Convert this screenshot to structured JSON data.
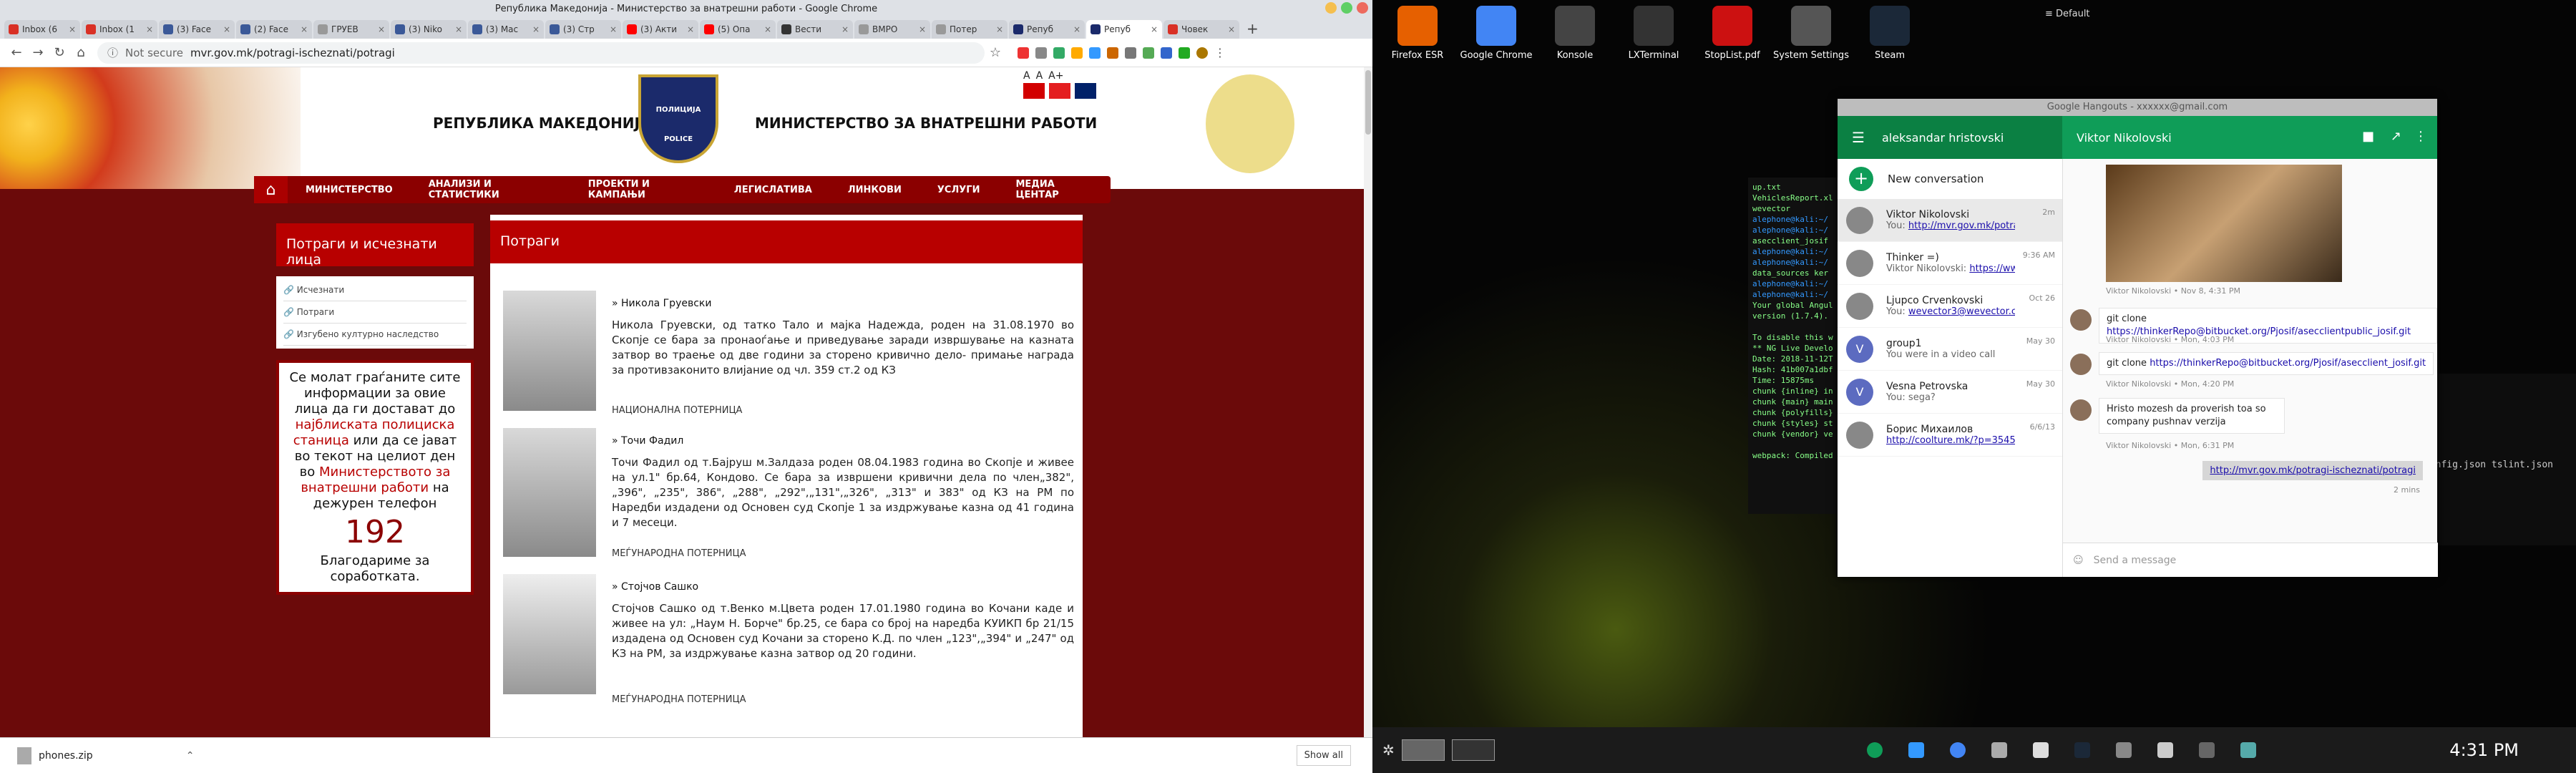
{
  "window": {
    "title": "Република Македонија - Министерство за внатрешни работи - Google Chrome"
  },
  "tabs": [
    {
      "label": "Inbox (6",
      "color": "#d93025"
    },
    {
      "label": "Inbox (1",
      "color": "#d93025"
    },
    {
      "label": "(3) Face",
      "color": "#3b5998"
    },
    {
      "label": "(2) Face",
      "color": "#3b5998"
    },
    {
      "label": "ГРУЕВ",
      "color": "#999999"
    },
    {
      "label": "(3) Niko",
      "color": "#3b5998"
    },
    {
      "label": "(3) Mac",
      "color": "#3b5998"
    },
    {
      "label": "(3) Стр",
      "color": "#3b5998"
    },
    {
      "label": "(3) Акти",
      "color": "#ff0000"
    },
    {
      "label": "(5) Опа",
      "color": "#ff0000"
    },
    {
      "label": "Вести",
      "color": "#333333"
    },
    {
      "label": "ВМРО",
      "color": "#999999"
    },
    {
      "label": "Потер",
      "color": "#999999"
    },
    {
      "label": "Репуб",
      "color": "#1b2a6b"
    },
    {
      "label": "Репуб",
      "color": "#1b2a6b"
    },
    {
      "label": "Човек",
      "color": "#d93025"
    }
  ],
  "omnibox": {
    "security": "Not secure",
    "url": "mvr.gov.mk/potragi-ischeznati/potragi"
  },
  "site": {
    "republic": "РЕПУБЛИКА МАКЕДОНИЈА",
    "ministry": "МИНИСТЕРСТВО ЗА ВНАТРЕШНИ РАБОТИ",
    "badge_top": "ПОЛИЦИЈА",
    "badge_bottom": "POLICE",
    "font_sizes": [
      "A",
      "A",
      "A+"
    ],
    "menu": [
      "МИНИСТЕРСТВО",
      "АНАЛИЗИ И СТАТИСТИКИ",
      "ПРОЕКТИ И КАМПАЊИ",
      "ЛЕГИСЛАТИВА",
      "ЛИНКОВИ",
      "УСЛУГИ",
      "МЕДИА ЦЕНТАР"
    ],
    "sidebar": {
      "title": "Потраги и исчезнати лица",
      "links": [
        "Исчезнати",
        "Потраги",
        "Изгубено културно наследство"
      ],
      "call_1": "Се молат граѓаните сите информации за овие лица да ги достават до",
      "call_2": "најблиската полициска станица",
      "call_3": "или да се јават во текот на целиот ден во",
      "call_4": "Министерството за внатрешни работи",
      "call_5": "на дежурен телефон",
      "phone": "192",
      "thanks": "Благодариме за соработката."
    },
    "main_title": "Потраги",
    "persons": [
      {
        "name": "» Никола Груевски",
        "text": "Никола Груевски, од татко Тало и мајка Надежда, роден на 31.08.1970 во Скопје се бара за пронаоѓање и приведување заради извршување на казната затвор во траење од две години за сторено кривично дело- примање награда за противзаконито влијание од чл. 359 ст.2 од КЗ",
        "tag": "НАЦИОНАЛНА ПОТЕРНИЦА"
      },
      {
        "name": "» Точи Фадил",
        "text": "Точи Фадил од т.Бајруш м.Залдаза роден 08.04.1983 година во Скопје и живее на ул.1\" бр.64, Кондово. Се бара за извршени кривични дела по член„382\", „396\", „235\", 386\", „288\", „292\",„131\",„326\", „313\" и 383\" од КЗ на РМ по Наредби издадени од Основен суд Скопје 1 за издржување казна од 41 година и 7 месеци.",
        "tag": "МЕЃУНАРОДНА ПОТЕРНИЦА"
      },
      {
        "name": "» Стојчов Сашко",
        "text": "Стојчов Сашко од т.Венко м.Цвета роден 17.01.1980 година во Кочани каде и живее на ул: „Наум Н. Борче\" бр.25, се бара со број на наредба КУИКП бр 21/15 издадена од Основен суд Кочани за сторено К.Д. по член „123\",„394\" и „247\" од КЗ на РМ, за издржување казна затвор од 20 години.",
        "tag": "МЕЃУНАРОДНА ПОТЕРНИЦА"
      }
    ]
  },
  "downloads": {
    "file": "phones.zip",
    "show_all": "Show all"
  },
  "desktop": {
    "icons": [
      "Firefox ESR",
      "Google Chrome",
      "Konsole",
      "LXTerminal",
      "StopList.pdf",
      "System Settings",
      "Steam"
    ],
    "icon_colors": [
      "#e66000",
      "#4285f4",
      "#444444",
      "#333333",
      "#cc1111",
      "#555555",
      "#1b2838"
    ],
    "activity": "Default",
    "clock": "4:31 PM"
  },
  "terminal": {
    "lines": [
      "up.txt",
      "VehiclesReport.xl",
      "wevector",
      "alephone@kali:~/",
      "alephone@kali:~/",
      "asecclient_josif",
      "alephone@kali:~/",
      "alephone@kali:~/",
      "data_sources  ker",
      "alephone@kali:~/",
      "alephone@kali:~/",
      "Your global Angul",
      "version (1.7.4).",
      "",
      "To disable this w",
      "** NG Live Develo",
      "Date: 2018-11-12T",
      "Hash: 41b007a1dbf",
      "Time: 15875ms",
      "chunk {inline} in",
      "chunk {main} main",
      "chunk {polyfills}",
      "chunk {styles} st",
      "chunk {vendor} ve",
      "",
      "webpack: Compiled"
    ],
    "other": "config.json  tslint.json"
  },
  "hangouts": {
    "title": "Google Hangouts - xxxxxx@gmail.com",
    "account": "aleksandar hristovski",
    "chat_with": "Viktor Nikolovski",
    "new_conversation": "New conversation",
    "conversations": [
      {
        "name": "Viktor Nikolovski",
        "msg_prefix": "You: ",
        "msg_link": "http://mvr.gov.mk/potragi-isc",
        "time": "2m",
        "avatar": ""
      },
      {
        "name": "Thinker =)",
        "msg_prefix": "Viktor Nikolovski: ",
        "msg_link": "https://www.mc",
        "time": "9:36 AM",
        "avatar": ""
      },
      {
        "name": "Ljupco Crvenkovski",
        "msg_prefix": "You: ",
        "msg_link": "wevector3@wevector.com",
        "time": "Oct 26",
        "avatar": ""
      },
      {
        "name": "group1",
        "msg_prefix": "You were in a video call",
        "msg_link": "",
        "time": "May 30",
        "avatar": "V"
      },
      {
        "name": "Vesna Petrovska",
        "msg_prefix": "You: sega?",
        "msg_link": "",
        "time": "May 30",
        "avatar": "V"
      },
      {
        "name": "Борис Михаилов",
        "msg_prefix": "",
        "msg_link": "http://coolture.mk/?p=35453",
        "time": "6/6/13",
        "avatar": ""
      }
    ],
    "messages": {
      "img_meta": "Viktor Nikolovski • Nov 8, 4:31 PM",
      "m1_pre": "git clone ",
      "m1_link": "https://thinkerRepo@bitbucket.org/Pjosif/asecclientpublic_josif.git",
      "m1_meta": "Viktor Nikolovski • Mon, 4:03 PM",
      "m2_pre": "git clone ",
      "m2_link": "https://thinkerRepo@bitbucket.org/Pjosif/asecclient_josif.git",
      "m2_meta": "Viktor Nikolovski • Mon, 4:20 PM",
      "m3": "Hristo mozesh da proverish toa so company pushnav verzija",
      "m3_meta": "Viktor Nikolovski • Mon, 6:31 PM",
      "mine": "http://mvr.gov.mk/potragi-ischeznati/potragi",
      "mine_meta": "2 mins"
    },
    "send_placeholder": "Send a message"
  }
}
